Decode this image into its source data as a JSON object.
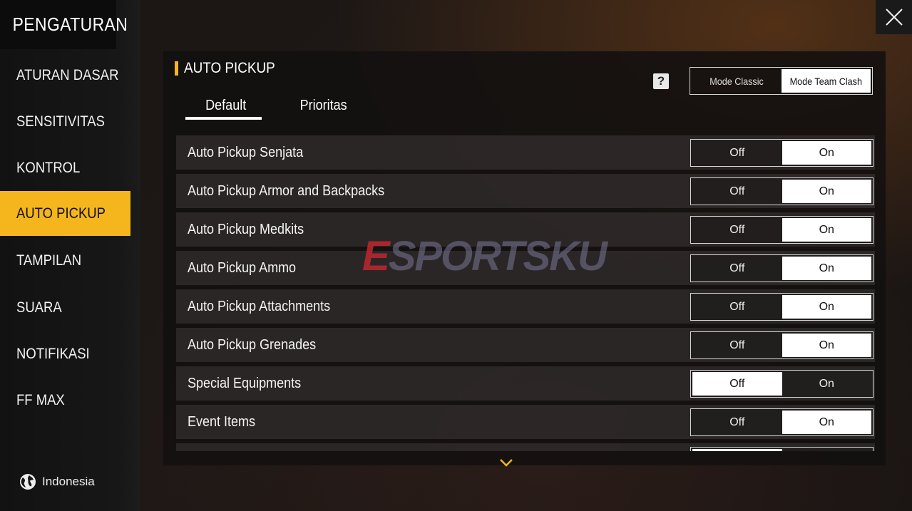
{
  "sidebar": {
    "title": "PENGATURAN",
    "items": [
      {
        "label": "ATURAN DASAR"
      },
      {
        "label": "SENSITIVITAS"
      },
      {
        "label": "KONTROL"
      },
      {
        "label": "AUTO PICKUP"
      },
      {
        "label": "TAMPILAN"
      },
      {
        "label": "SUARA"
      },
      {
        "label": "NOTIFIKASI"
      },
      {
        "label": "FF MAX"
      }
    ],
    "active_item": "AUTO PICKUP",
    "language": "Indonesia"
  },
  "header": {
    "section_title": "AUTO PICKUP",
    "help_icon": "?",
    "mode": {
      "options": [
        "Mode Classic",
        "Mode Team Clash"
      ],
      "selected": "Mode Team Clash"
    },
    "tabs": [
      {
        "label": "Default"
      },
      {
        "label": "Prioritas"
      }
    ],
    "active_tab": "Default"
  },
  "rows": [
    {
      "label": "Auto Pickup Senjata",
      "off": "Off",
      "on": "On",
      "value": "On"
    },
    {
      "label": "Auto Pickup Armor and Backpacks",
      "off": "Off",
      "on": "On",
      "value": "On"
    },
    {
      "label": "Auto Pickup Medkits",
      "off": "Off",
      "on": "On",
      "value": "On"
    },
    {
      "label": "Auto Pickup Ammo",
      "off": "Off",
      "on": "On",
      "value": "On"
    },
    {
      "label": "Auto Pickup Attachments",
      "off": "Off",
      "on": "On",
      "value": "On"
    },
    {
      "label": "Auto Pickup Grenades",
      "off": "Off",
      "on": "On",
      "value": "On"
    },
    {
      "label": "Special Equipments",
      "off": "Off",
      "on": "On",
      "value": "Off"
    },
    {
      "label": "Event Items",
      "off": "Off",
      "on": "On",
      "value": "On"
    },
    {
      "label": "",
      "off": "",
      "on": "",
      "value": "Off"
    }
  ],
  "watermark": {
    "first": "E",
    "rest": "SPORTSKU"
  },
  "colors": {
    "accent": "#f5b61d",
    "panel": "#121010",
    "row": "#3a3434"
  }
}
